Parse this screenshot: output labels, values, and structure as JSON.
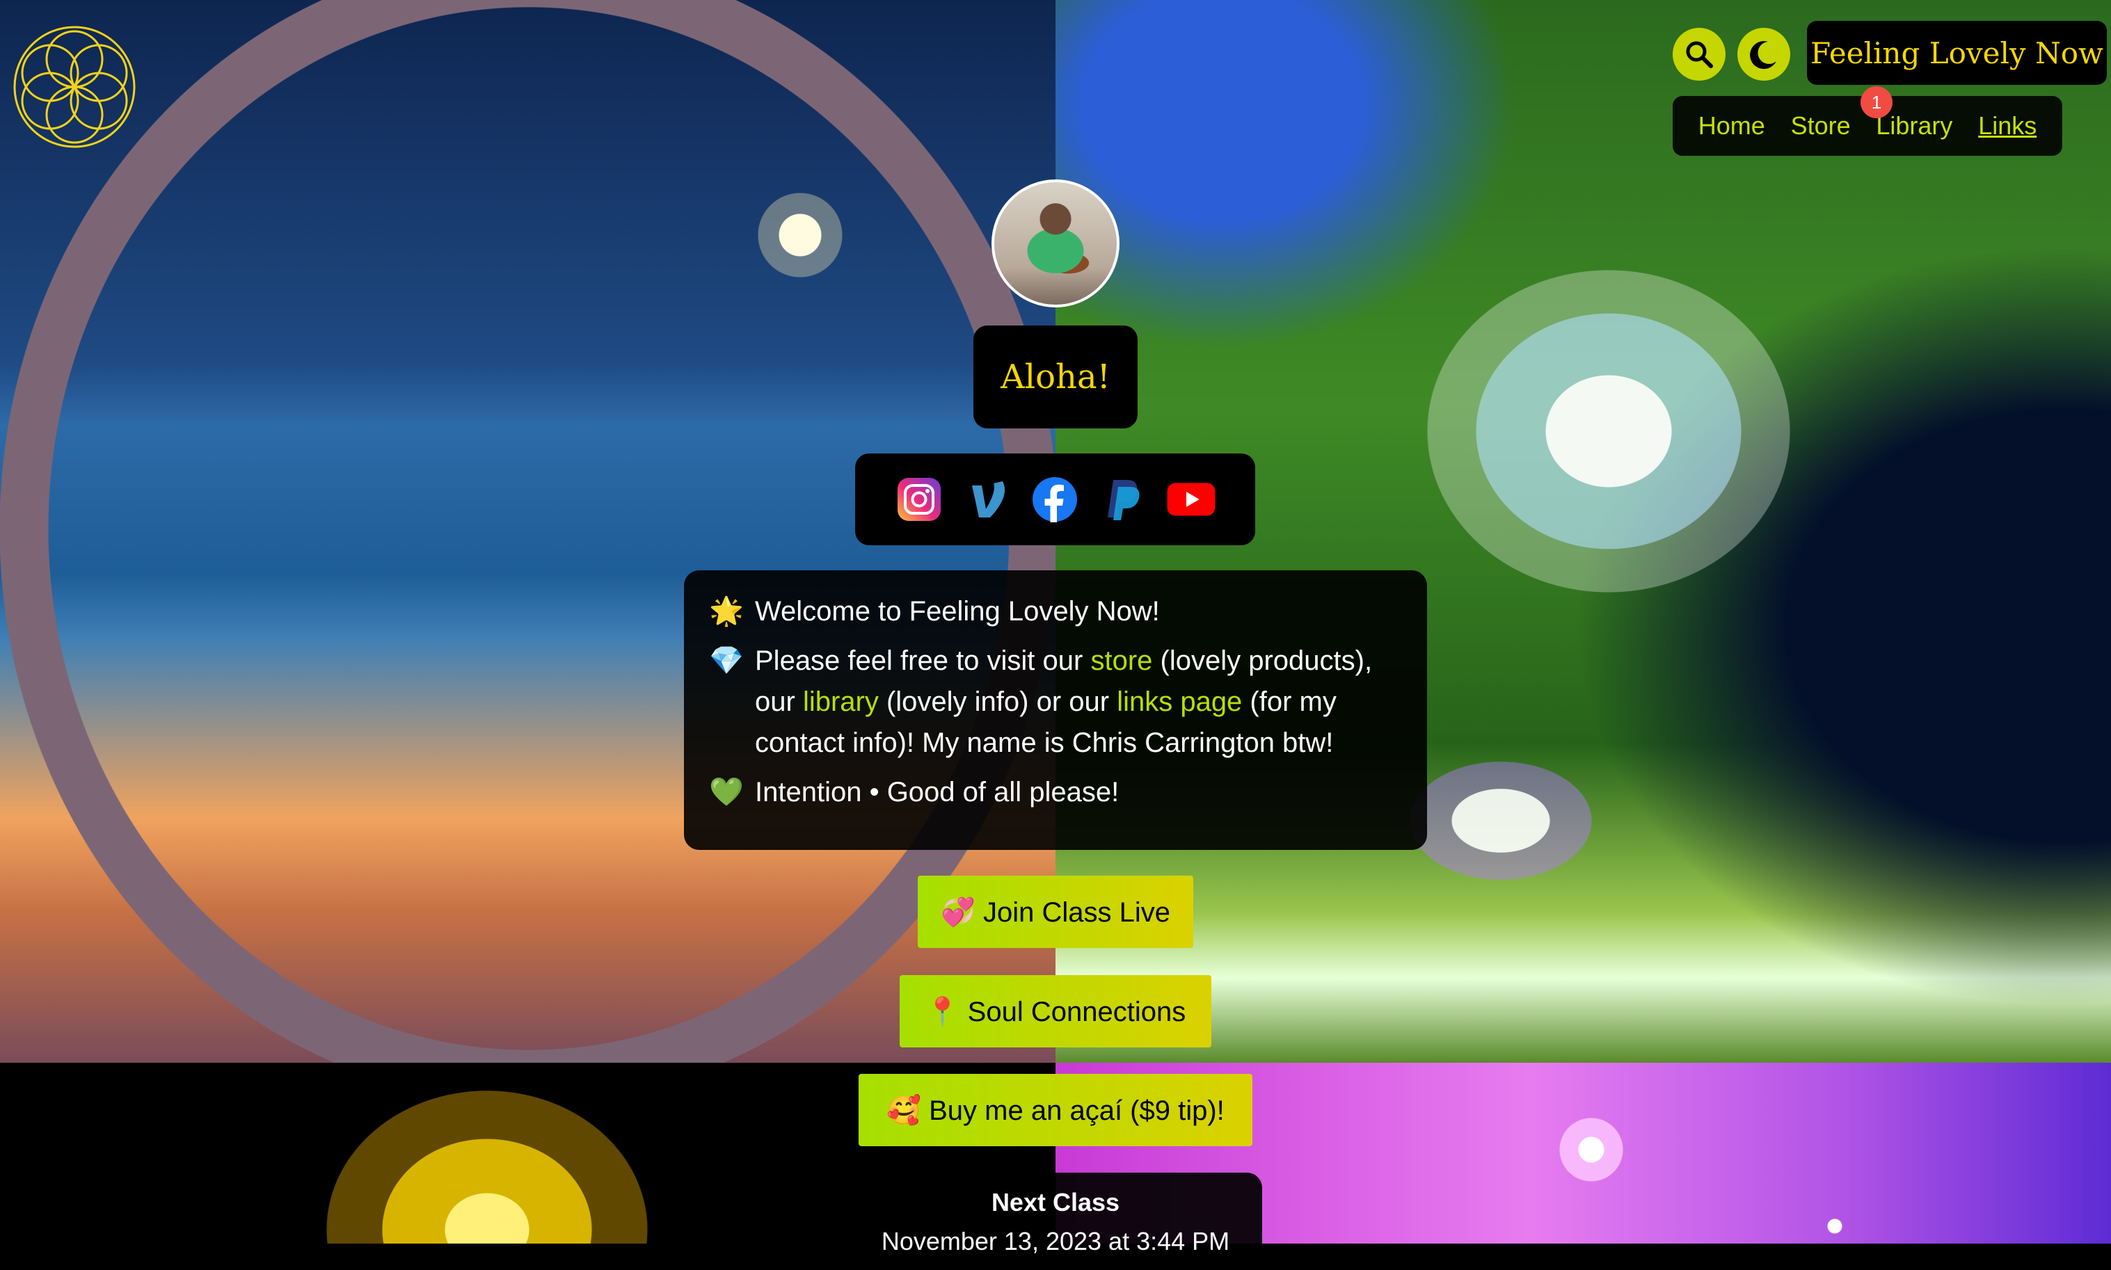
{
  "brand": {
    "title": "Feeling Lovely Now"
  },
  "nav": {
    "items": [
      {
        "label": "Home"
      },
      {
        "label": "Store",
        "badge": "1"
      },
      {
        "label": "Library"
      },
      {
        "label": "Links",
        "active": true
      }
    ]
  },
  "icons": {
    "search": "search-icon",
    "dark_mode": "moon-icon",
    "logo": "flower-of-life-icon"
  },
  "greeting": "Aloha!",
  "social": [
    "instagram-icon",
    "venmo-icon",
    "facebook-icon",
    "paypal-icon",
    "youtube-icon"
  ],
  "welcome": {
    "line1_emoji": "🌟",
    "line1": "Welcome to Feeling Lovely Now!",
    "line2_emoji": "💎",
    "line2_a": "Please feel free to visit our ",
    "line2_store": "store",
    "line2_b": " (lovely products), our ",
    "line2_library": "library",
    "line2_c": " (lovely info) or our ",
    "line2_links": "links page",
    "line2_d": " (for my contact info)! My name is Chris Carrington btw!",
    "line3_emoji": "💚",
    "line3": "Intention • Good of all please!"
  },
  "buttons": {
    "live": "💞 Join Class Live",
    "soul": "📍 Soul Connections",
    "tip": "🥰 Buy me an açaí ($9 tip)!"
  },
  "next_class": {
    "title": "Next Class",
    "date": "November 13, 2023 at 3:44 PM"
  },
  "colors": {
    "accent": "#c8e000",
    "brand_text": "#f5d800",
    "badge": "#f24b42"
  }
}
